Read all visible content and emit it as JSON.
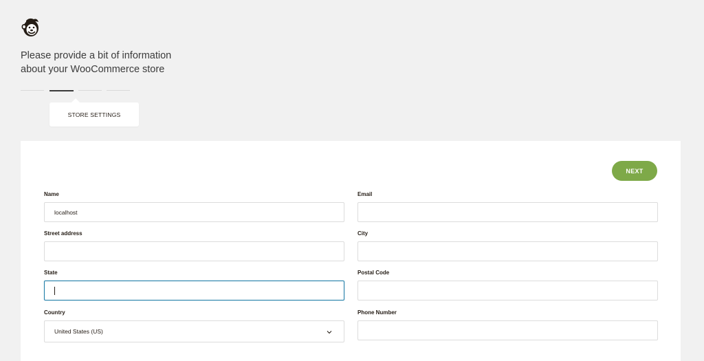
{
  "header": {
    "logo_icon": "mailchimp-freddie-icon",
    "intro_line1": "Please provide a bit of information",
    "intro_line2": "about your WooCommerce store"
  },
  "stepper": {
    "total_steps": 4,
    "active_step": 2,
    "active_label": "STORE SETTINGS"
  },
  "form": {
    "next_label": "NEXT",
    "fields": {
      "name": {
        "label": "Name",
        "value": "localhost"
      },
      "email": {
        "label": "Email",
        "value": ""
      },
      "street": {
        "label": "Street address",
        "value": ""
      },
      "city": {
        "label": "City",
        "value": ""
      },
      "state": {
        "label": "State",
        "value": ""
      },
      "postal": {
        "label": "Postal Code",
        "value": ""
      },
      "country": {
        "label": "Country",
        "value": "United States (US)"
      },
      "phone": {
        "label": "Phone Number",
        "value": ""
      }
    }
  },
  "colors": {
    "background": "#f1f1f1",
    "card": "#ffffff",
    "accent_green": "#7ea948",
    "focus_blue": "#1c7ba6",
    "text": "#241c15"
  }
}
